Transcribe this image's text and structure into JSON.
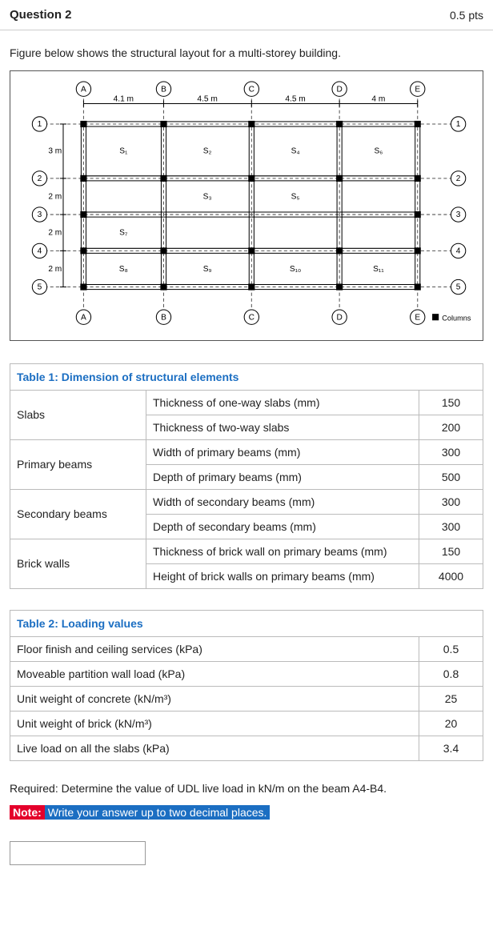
{
  "header": {
    "title": "Question 2",
    "points": "0.5 pts"
  },
  "intro": "Figure below shows the structural layout for a multi-storey building.",
  "figure": {
    "col_labels": [
      "A",
      "B",
      "C",
      "D",
      "E"
    ],
    "col_spans": [
      {
        "label": "4.1 m"
      },
      {
        "label": "4.5 m"
      },
      {
        "label": "4.5 m"
      },
      {
        "label": "4 m"
      }
    ],
    "row_labels": [
      "1",
      "2",
      "3",
      "4",
      "5"
    ],
    "row_spans": [
      {
        "label": "3 m"
      },
      {
        "label": "2 m"
      },
      {
        "label": "2 m"
      },
      {
        "label": "2 m"
      }
    ],
    "slab_labels": [
      "S₁",
      "S₂",
      "S₃",
      "S₄",
      "S₅",
      "S₆",
      "S₇",
      "S₈",
      "S₉",
      "S₁₀",
      "S₁₁"
    ],
    "legend": "Columns"
  },
  "table1": {
    "caption": "Table 1: Dimension of structural elements",
    "groups": [
      {
        "name": "Slabs",
        "rows": [
          {
            "label": "Thickness of one-way slabs (mm)",
            "value": "150"
          },
          {
            "label": "Thickness of two-way slabs",
            "value": "200"
          }
        ]
      },
      {
        "name": "Primary beams",
        "rows": [
          {
            "label": "Width of primary beams (mm)",
            "value": "300"
          },
          {
            "label": "Depth of primary beams (mm)",
            "value": "500"
          }
        ]
      },
      {
        "name": "Secondary beams",
        "rows": [
          {
            "label": "Width of secondary beams (mm)",
            "value": "300"
          },
          {
            "label": "Depth of secondary beams (mm)",
            "value": "300"
          }
        ]
      },
      {
        "name": "Brick walls",
        "rows": [
          {
            "label": "Thickness of brick wall on primary beams (mm)",
            "value": "150"
          },
          {
            "label": "Height of brick walls on primary beams (mm)",
            "value": "4000"
          }
        ]
      }
    ]
  },
  "table2": {
    "caption": "Table 2: Loading values",
    "rows": [
      {
        "label": "Floor finish and ceiling services (kPa)",
        "value": "0.5"
      },
      {
        "label": "Moveable partition wall load (kPa)",
        "value": "0.8"
      },
      {
        "label": "Unit weight of concrete (kN/m³)",
        "value": "25"
      },
      {
        "label": "Unit weight of brick (kN/m³)",
        "value": "20"
      },
      {
        "label": "Live load on all  the slabs (kPa)",
        "value": "3.4"
      }
    ]
  },
  "required": "Required: Determine the value of UDL live load in kN/m on the beam A4-B4.",
  "note_label": "Note:",
  "note_text": "Write your answer up to two decimal places.",
  "answer_placeholder": ""
}
